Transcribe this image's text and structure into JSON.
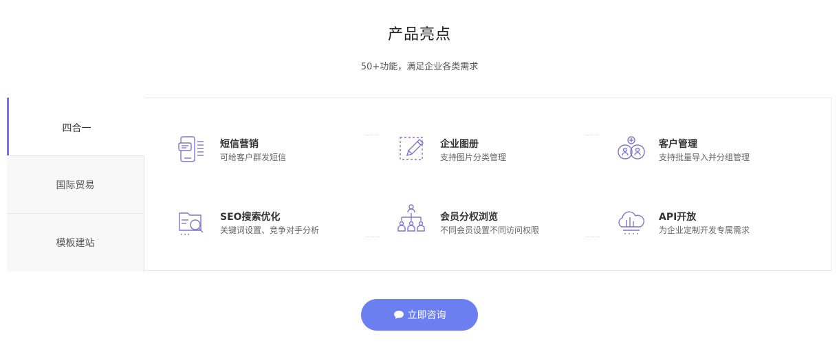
{
  "section": {
    "title": "产品亮点",
    "subtitle": "50+功能，满足企业各类需求"
  },
  "tabs": [
    {
      "label": "四合一",
      "active": true
    },
    {
      "label": "国际贸易",
      "active": false
    },
    {
      "label": "模板建站",
      "active": false
    }
  ],
  "features": [
    {
      "name": "短信营销",
      "desc": "可给客户群发短信",
      "icon": "sms-phone-icon"
    },
    {
      "name": "企业图册",
      "desc": "支持图片分类管理",
      "icon": "edit-pencil-icon"
    },
    {
      "name": "客户管理",
      "desc": "支持批量导入并分组管理",
      "icon": "customer-group-icon"
    },
    {
      "name": "SEO搜索优化",
      "desc": "关键词设置、竞争对手分析",
      "icon": "seo-search-icon"
    },
    {
      "name": "会员分权浏览",
      "desc": "不同会员设置不同访问权限",
      "icon": "member-hierarchy-icon"
    },
    {
      "name": "API开放",
      "desc": "为企业定制开发专属需求",
      "icon": "cloud-api-icon"
    }
  ],
  "cta": {
    "label": "立即咨询",
    "icon": "chat-bubble-icon"
  },
  "colors": {
    "accent": "#7a72d8",
    "button": "#6b7ff1",
    "icon_stroke": "#7b74d4"
  }
}
